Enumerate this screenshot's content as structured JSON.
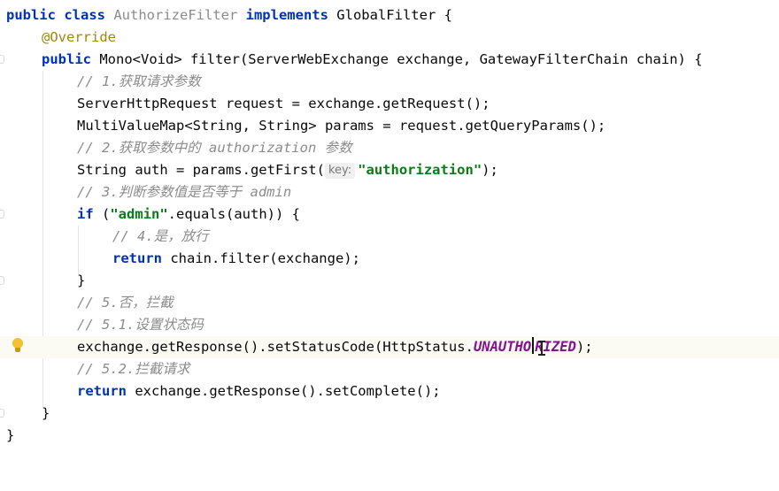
{
  "editor": {
    "l1": {
      "kw1": "public class ",
      "cls": "AuthorizeFilter ",
      "kw2": "implements ",
      "rest": "GlobalFilter {"
    },
    "l2": {
      "ann": "@Override"
    },
    "l3": {
      "kw": "public ",
      "rest": "Mono<Void> filter(ServerWebExchange exchange, GatewayFilterChain chain) {"
    },
    "l4": {
      "cmt": "// 1.获取请求参数"
    },
    "l5": {
      "code": "ServerHttpRequest request = exchange.getRequest();"
    },
    "l6": {
      "code": "MultiValueMap<String, String> params = request.getQueryParams();"
    },
    "l7": {
      "cmt": "// 2.获取参数中的 authorization 参数"
    },
    "l8": {
      "pre": "String auth = params.getFirst(",
      "hint": "key:",
      "str": "\"authorization\"",
      "post": ");"
    },
    "l9": {
      "cmt": "// 3.判断参数值是否等于 admin"
    },
    "l10": {
      "kw": "if ",
      "p1": "(",
      "str": "\"admin\"",
      "post": ".equals(auth)) {"
    },
    "l11": {
      "cmt": "// 4.是，放行"
    },
    "l12": {
      "kw": "return ",
      "rest": "chain.filter(exchange);"
    },
    "l13": {
      "code": "}"
    },
    "l14": {
      "cmt": "// 5.否，拦截"
    },
    "l15": {
      "cmt": "// 5.1.设置状态码"
    },
    "l16": {
      "pre": "exchange.getResponse().setStatusCode(HttpStatus.",
      "c1": "UNAUTHO",
      "c2": "RIZED",
      "post": ");"
    },
    "l17": {
      "cmt": "// 5.2.拦截请求"
    },
    "l18": {
      "kw": "return ",
      "rest": "exchange.getResponse().setComplete();"
    },
    "l19": {
      "code": "}"
    },
    "l20": {
      "code": "}"
    }
  },
  "icons": {
    "bulb": "lightbulb-icon",
    "cursor": "text-cursor-icon"
  }
}
